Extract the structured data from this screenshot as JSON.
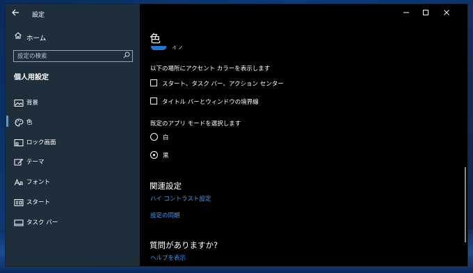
{
  "app": {
    "title": "設定"
  },
  "sidebar": {
    "home_label": "ホーム",
    "search_placeholder": "設定の検索",
    "section_title": "個人用設定",
    "items": [
      {
        "label": "背景",
        "icon": "picture-icon"
      },
      {
        "label": "色",
        "icon": "palette-icon",
        "active": true
      },
      {
        "label": "ロック画面",
        "icon": "lock-screen-icon"
      },
      {
        "label": "テーマ",
        "icon": "theme-icon"
      },
      {
        "label": "フォント",
        "icon": "font-icon"
      },
      {
        "label": "スタート",
        "icon": "start-icon"
      },
      {
        "label": "タスク バー",
        "icon": "taskbar-icon"
      }
    ]
  },
  "content": {
    "page_title": "色",
    "partial_toggle_text": "オフ",
    "accent_surfaces_label": "以下の場所にアクセント カラーを表示します",
    "checkboxes": [
      {
        "label": "スタート、タスク バー、アクション センター",
        "checked": false
      },
      {
        "label": "タイトル バーとウィンドウの境界線",
        "checked": false
      }
    ],
    "app_mode_label": "既定のアプリ モードを選択します",
    "radios": [
      {
        "label": "白",
        "selected": false
      },
      {
        "label": "黒",
        "selected": true
      }
    ],
    "related_heading": "関連設定",
    "related_links": [
      "ハイ コントラスト設定",
      "設定の同期"
    ],
    "question_heading": "質問がありますか?",
    "help_link": "ヘルプを表示"
  },
  "colors": {
    "sidebar_bg": "#1f2e3b",
    "content_bg": "#000000",
    "accent": "#1e78d0",
    "link": "#3d9bf0"
  }
}
